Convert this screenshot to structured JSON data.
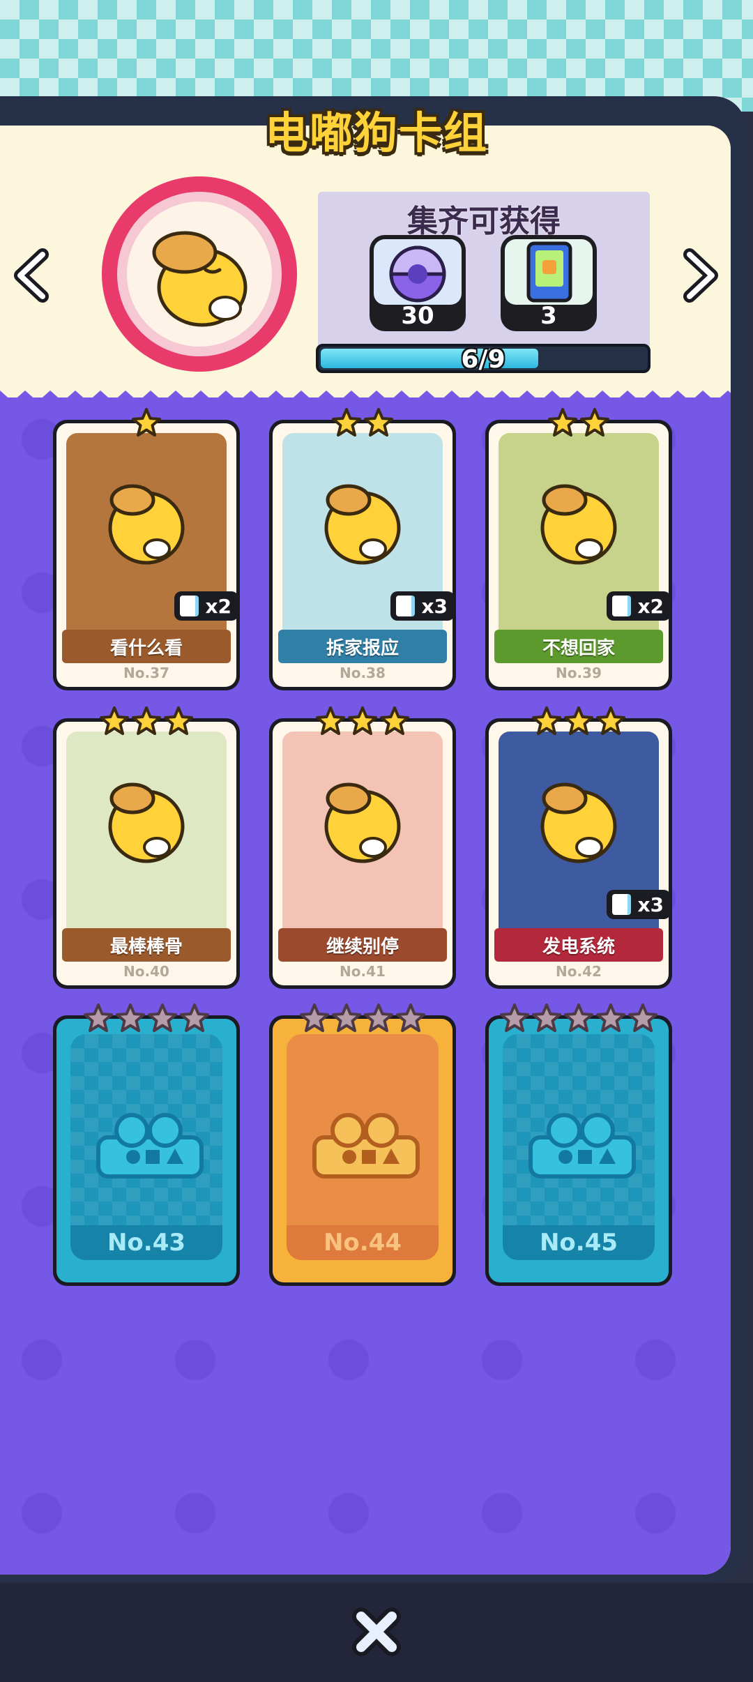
{
  "title": "电嘟狗卡组",
  "reward": {
    "title": "集齐可获得",
    "items": [
      {
        "icon": "capsule-icon",
        "count": "30"
      },
      {
        "icon": "card-pack-icon",
        "count": "3"
      }
    ]
  },
  "progress": {
    "text": "6/9",
    "value": 0.6667
  },
  "cards": [
    {
      "name": "看什么看",
      "no": "No.37",
      "stars": 1,
      "dup": "x2",
      "banner": "#9a5a2c",
      "art": "#b5763e"
    },
    {
      "name": "拆家报应",
      "no": "No.38",
      "stars": 2,
      "dup": "x3",
      "banner": "#2f7fa6",
      "art": "#bfe1e8"
    },
    {
      "name": "不想回家",
      "no": "No.39",
      "stars": 2,
      "dup": "x2",
      "banner": "#5d9a2e",
      "art": "#c7d38a"
    },
    {
      "name": "最棒棒骨",
      "no": "No.40",
      "stars": 3,
      "dup": "",
      "banner": "#9a5a2c",
      "art": "#dfe8c4"
    },
    {
      "name": "继续别停",
      "no": "No.41",
      "stars": 3,
      "dup": "",
      "banner": "#9b4a2e",
      "art": "#f3c3b6"
    },
    {
      "name": "发电系统",
      "no": "No.42",
      "stars": 3,
      "dup": "x3",
      "banner": "#b3283a",
      "art": "#3e5aa0"
    }
  ],
  "locked_cards": [
    {
      "no": "No.43",
      "stars": 4,
      "theme": "blue"
    },
    {
      "no": "No.44",
      "stars": 4,
      "theme": "gold"
    },
    {
      "no": "No.45",
      "stars": 5,
      "theme": "blue"
    }
  ]
}
